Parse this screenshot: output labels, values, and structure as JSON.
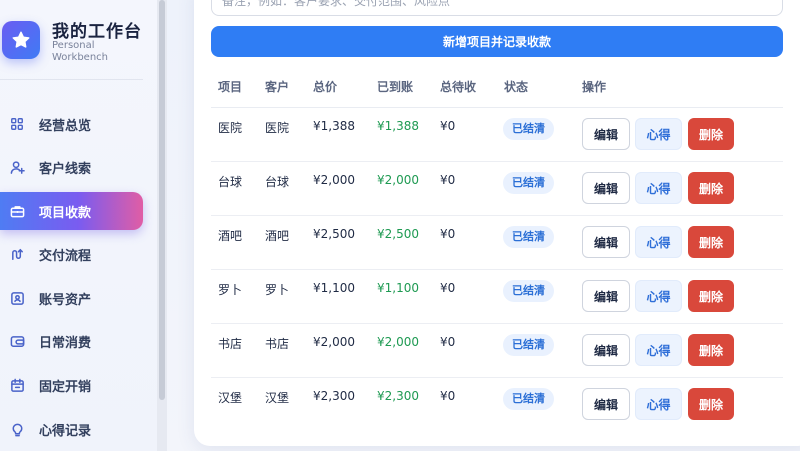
{
  "brand": {
    "title": "我的工作台",
    "subtitle": "Personal Workbench"
  },
  "sidebar": {
    "items": [
      {
        "label": "经营总览",
        "icon": "grid-icon",
        "active": false
      },
      {
        "label": "客户线索",
        "icon": "user-plus-icon",
        "active": false
      },
      {
        "label": "项目收款",
        "icon": "briefcase-icon",
        "active": true
      },
      {
        "label": "交付流程",
        "icon": "flow-icon",
        "active": false
      },
      {
        "label": "账号资产",
        "icon": "id-card-icon",
        "active": false
      },
      {
        "label": "日常消费",
        "icon": "wallet-icon",
        "active": false
      },
      {
        "label": "固定开销",
        "icon": "calendar-icon",
        "active": false
      },
      {
        "label": "心得记录",
        "icon": "lightbulb-icon",
        "active": false
      }
    ]
  },
  "form": {
    "note_placeholder": "备注，例如：客户要求、交付范围、风险点",
    "submit_label": "新增项目并记录收款"
  },
  "table": {
    "headers": [
      "项目",
      "客户",
      "总价",
      "已到账",
      "总待收",
      "状态",
      "操作"
    ],
    "rows": [
      {
        "project": "医院",
        "client": "医院",
        "total": "¥1,388",
        "received": "¥1,388",
        "pending": "¥0",
        "status": "已结清"
      },
      {
        "project": "台球",
        "client": "台球",
        "total": "¥2,000",
        "received": "¥2,000",
        "pending": "¥0",
        "status": "已结清"
      },
      {
        "project": "酒吧",
        "client": "酒吧",
        "total": "¥2,500",
        "received": "¥2,500",
        "pending": "¥0",
        "status": "已结清"
      },
      {
        "project": "罗卜",
        "client": "罗卜",
        "total": "¥1,100",
        "received": "¥1,100",
        "pending": "¥0",
        "status": "已结清"
      },
      {
        "project": "书店",
        "client": "书店",
        "total": "¥2,000",
        "received": "¥2,000",
        "pending": "¥0",
        "status": "已结清"
      },
      {
        "project": "汉堡",
        "client": "汉堡",
        "total": "¥2,300",
        "received": "¥2,300",
        "pending": "¥0",
        "status": "已结清"
      }
    ],
    "actions": {
      "edit": "编辑",
      "note": "心得",
      "delete": "删除"
    }
  },
  "colors": {
    "primary": "#2f7df4",
    "paid": "#1e9a52",
    "danger": "#d9483b",
    "badge_bg": "#e9f1fe",
    "badge_text": "#2b6fd6"
  }
}
